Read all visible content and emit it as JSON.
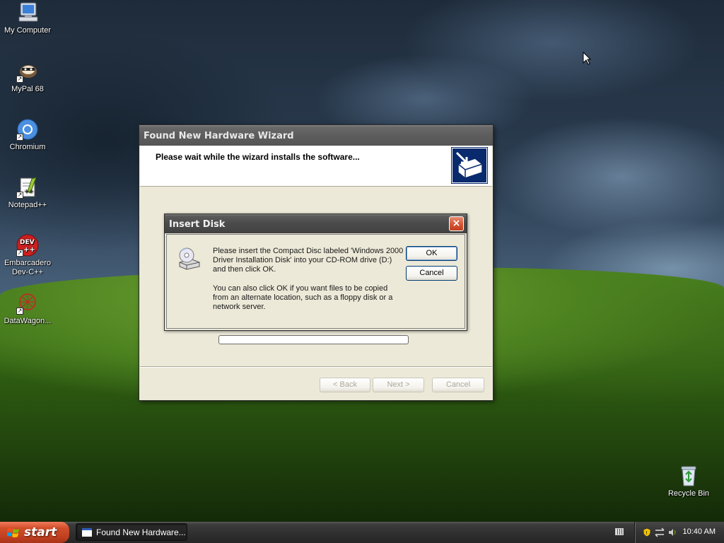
{
  "desktop": {
    "icons": [
      {
        "label": "My Computer",
        "icon": "my-computer-icon"
      },
      {
        "label": "MyPal 68",
        "icon": "mypal-icon"
      },
      {
        "label": "Chromium",
        "icon": "chromium-icon"
      },
      {
        "label": "Notepad++",
        "icon": "notepad-plus-plus-icon"
      },
      {
        "label": "Embarcadero Dev-C++",
        "icon": "devcpp-icon"
      },
      {
        "label": "DataWagon...",
        "icon": "datawagon-icon"
      },
      {
        "label": "Recycle Bin",
        "icon": "recycle-bin-icon"
      }
    ]
  },
  "wizard": {
    "title": "Found New Hardware Wizard",
    "header_title": "Please wait while the wizard installs the software...",
    "progress": 0,
    "buttons": {
      "back": "< Back",
      "next": "Next >",
      "cancel": "Cancel"
    }
  },
  "insert_disk": {
    "title": "Insert Disk",
    "close": "×",
    "message1": "Please insert the Compact Disc labeled 'Windows 2000 Driver Installation Disk' into your CD-ROM drive (D:) and then click OK.",
    "message2": "You can also click OK if you want files to be copied from an alternate location, such as a floppy disk or a network server.",
    "ok": "OK",
    "cancel": "Cancel"
  },
  "taskbar": {
    "start": "start",
    "task": "Found New Hardware...",
    "clock": "10:40 AM"
  },
  "colors": {
    "start_button": "#d24e2a",
    "titlebar": "#5d5d5d",
    "dialog_face": "#ece9d8",
    "wizard_graphic": "#0a2a6e"
  }
}
